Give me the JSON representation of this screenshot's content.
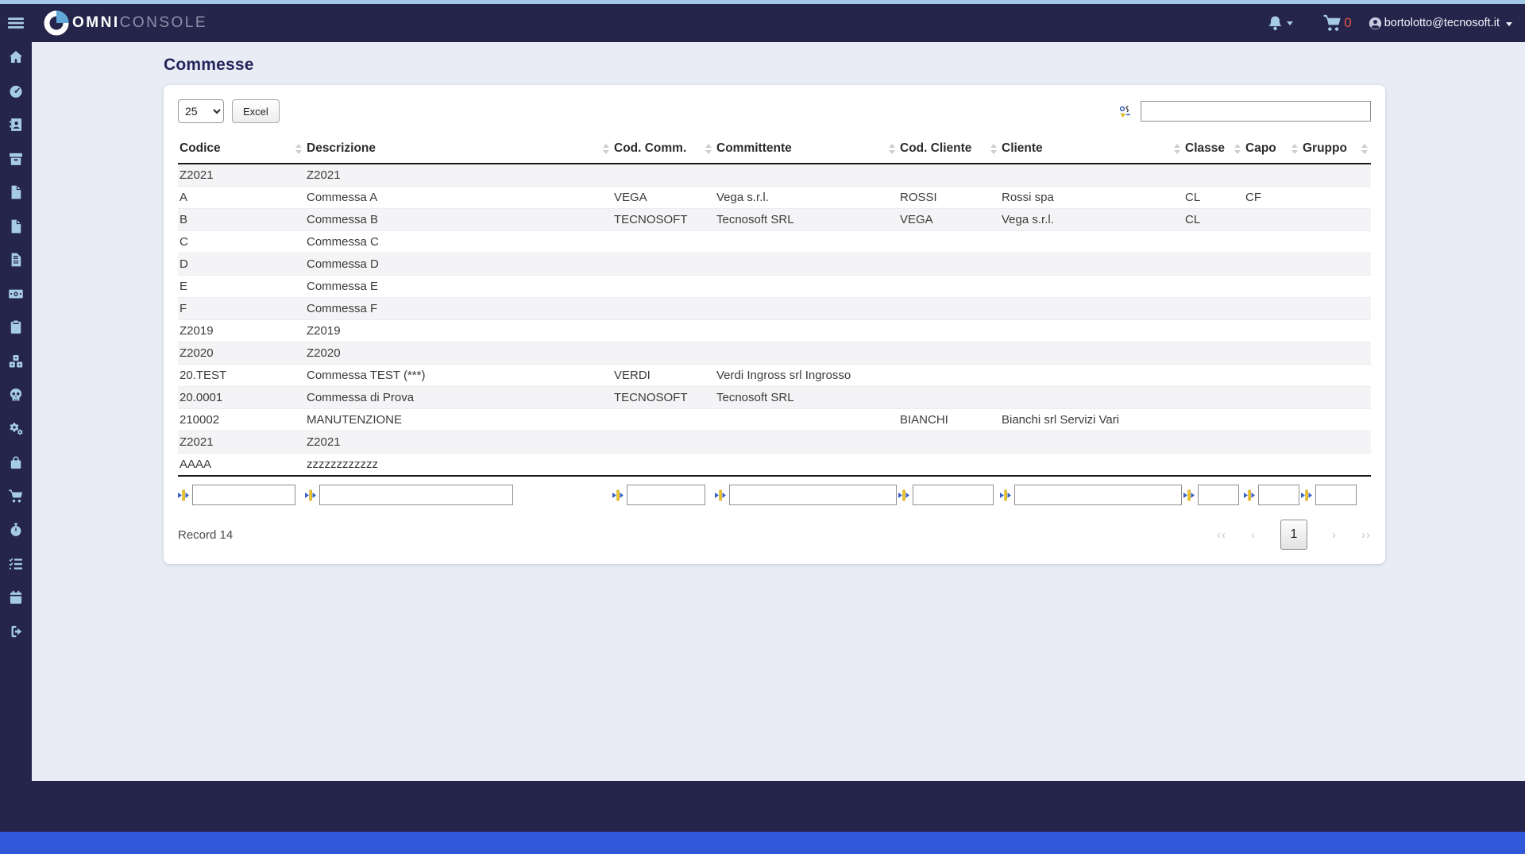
{
  "header": {
    "brand_omni": "OMNI",
    "brand_console": "CONSOLE",
    "cart_count": "0",
    "user_email": "bortolotto@tecnosoft.it",
    "icons": [
      "hamburger-menu",
      "brand-pie-logo",
      "bell",
      "shopping-cart",
      "user-avatar"
    ]
  },
  "sidebar": {
    "icons": [
      "home",
      "dashboard-gauge",
      "address-book",
      "archive-box",
      "file",
      "file",
      "file-invoice",
      "money-bill",
      "clipboard",
      "dice",
      "skull",
      "gears",
      "shopping-bag",
      "shopping-cart",
      "stopwatch",
      "task-list",
      "calendar",
      "logout"
    ]
  },
  "page": {
    "title": "Commesse"
  },
  "toolbar": {
    "page_size": "25",
    "excel_label": "Excel"
  },
  "table": {
    "columns": [
      "Codice",
      "Descrizione",
      "Cod. Comm.",
      "Committente",
      "Cod. Cliente",
      "Cliente",
      "Classe",
      "Capo",
      "Gruppo"
    ],
    "rows": [
      [
        "Z2021",
        "Z2021",
        "",
        "",
        "",
        "",
        "",
        "",
        ""
      ],
      [
        "A",
        "Commessa A",
        "VEGA",
        "Vega s.r.l.",
        "ROSSI",
        "Rossi spa",
        "CL",
        "CF",
        ""
      ],
      [
        "B",
        "Commessa B",
        "TECNOSOFT",
        "Tecnosoft SRL",
        "VEGA",
        "Vega s.r.l.",
        "CL",
        "",
        ""
      ],
      [
        "C",
        "Commessa C",
        "",
        "",
        "",
        "",
        "",
        "",
        ""
      ],
      [
        "D",
        "Commessa D",
        "",
        "",
        "",
        "",
        "",
        "",
        ""
      ],
      [
        "E",
        "Commessa E",
        "",
        "",
        "",
        "",
        "",
        "",
        ""
      ],
      [
        "F",
        "Commessa F",
        "",
        "",
        "",
        "",
        "",
        "",
        ""
      ],
      [
        "Z2019",
        "Z2019",
        "",
        "",
        "",
        "",
        "",
        "",
        ""
      ],
      [
        "Z2020",
        "Z2020",
        "",
        "",
        "",
        "",
        "",
        "",
        ""
      ],
      [
        "20.TEST",
        "Commessa TEST (***)",
        "VERDI",
        "Verdi Ingross srl Ingrosso",
        "",
        "",
        "",
        "",
        ""
      ],
      [
        "20.0001",
        "Commessa di Prova",
        "TECNOSOFT",
        "Tecnosoft SRL",
        "",
        "",
        "",
        "",
        ""
      ],
      [
        "210002",
        "MANUTENZIONE",
        "",
        "",
        "BIANCHI",
        "Bianchi srl Servizi Vari",
        "",
        "",
        ""
      ],
      [
        "Z2021",
        "Z2021",
        "",
        "",
        "",
        "",
        "",
        "",
        ""
      ],
      [
        "AAAA",
        "zzzzzzzzzzzz",
        "",
        "",
        "",
        "",
        "",
        "",
        ""
      ]
    ]
  },
  "footer": {
    "record_label": "Record 14",
    "pagination": {
      "first": "‹‹",
      "prev": "‹",
      "current_page": "1",
      "next": "›",
      "last": "››"
    }
  },
  "colors": {
    "navy": "#25254b",
    "icon_blue": "#a6cbe7",
    "top_strip": "#a4c9e8",
    "bottom_strip": "#2f57d7",
    "page_bg": "#e9ecf4",
    "cart_count_red": "#e4564a",
    "title": "#23265a"
  }
}
